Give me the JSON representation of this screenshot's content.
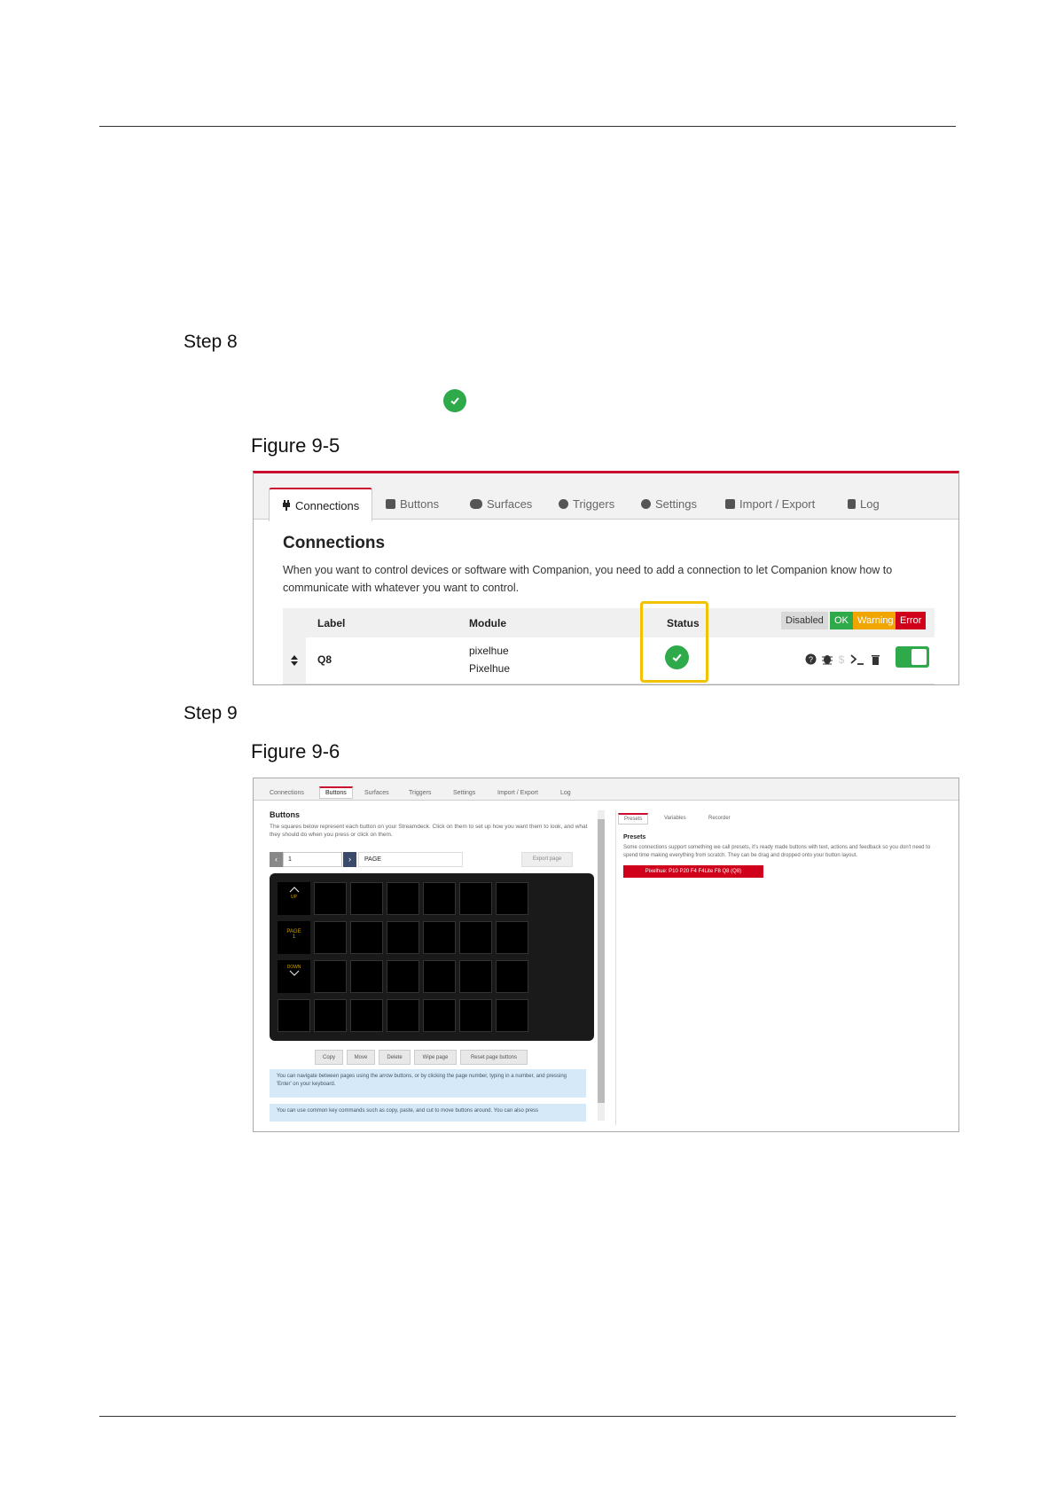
{
  "steps": {
    "step8": "Step 8",
    "step9": "Step 9"
  },
  "figures": {
    "fig95": "Figure 9-5",
    "fig96": "Figure 9-6"
  },
  "fig95": {
    "tabs": [
      "Connections",
      "Buttons",
      "Surfaces",
      "Triggers",
      "Settings",
      "Import / Export",
      "Log"
    ],
    "heading": "Connections",
    "description": "When you want to control devices or software with Companion, you need to add a connection to let Companion know how to communicate with whatever you want to control.",
    "table": {
      "headers": {
        "label": "Label",
        "module": "Module",
        "status": "Status"
      },
      "legend": [
        {
          "text": "Disabled",
          "color": "#d9d9d9",
          "text_color": "#333333"
        },
        {
          "text": "OK",
          "color": "#2eaa4a",
          "text_color": "#ffffff"
        },
        {
          "text": "Warning",
          "color": "#f0a500",
          "text_color": "#ffffff"
        },
        {
          "text": "Error",
          "color": "#d0021b",
          "text_color": "#ffffff"
        }
      ],
      "row": {
        "label": "Q8",
        "module_line1": "pixelhue",
        "module_line2": "Pixelhue",
        "status": "OK",
        "enabled": true
      }
    },
    "accent": "#c8102e",
    "highlight": "#f2c200"
  },
  "fig96": {
    "tabs": [
      "Connections",
      "Buttons",
      "Surfaces",
      "Triggers",
      "Settings",
      "Import / Export",
      "Log"
    ],
    "heading": "Buttons",
    "description": "The squares below represent each button on your Streamdeck. Click on them to set up how you want them to look, and what they should do when you press or click on them.",
    "page_number": "1",
    "page_name": "PAGE",
    "export_label": "Export page",
    "nav_keys": [
      "UP",
      "PAGE 1",
      "DOWN"
    ],
    "actions": [
      "Copy",
      "Move",
      "Delete",
      "Wipe page",
      "Reset page buttons"
    ],
    "info1": "You can navigate between pages using the arrow buttons, or by clicking the page number, typing in a number, and pressing 'Enter' on your keyboard.",
    "info2": "You can use common key commands such as copy, paste, and cut to move buttons around. You can also press",
    "right_tabs": [
      "Presets",
      "Variables",
      "Recorder"
    ],
    "presets_title": "Presets",
    "presets_desc": "Some connections support something we call presets, it's ready made buttons with text, actions and feedback so you don't need to spend time making everything from scratch. They can be drag and dropped onto your button layout.",
    "preset_button": "Pixelhue: P10 P20 F4 F4Lite F8 Q8 (Q8)"
  }
}
